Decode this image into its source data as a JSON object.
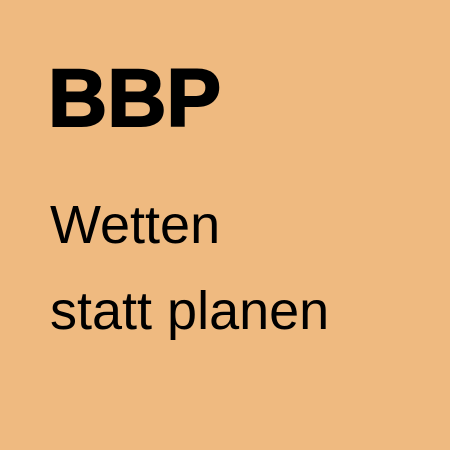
{
  "tile": {
    "background_color": "#efba80",
    "text_color": "#000000",
    "title": "BBP",
    "tagline": {
      "line1": "Wetten",
      "line2": "statt planen"
    }
  }
}
